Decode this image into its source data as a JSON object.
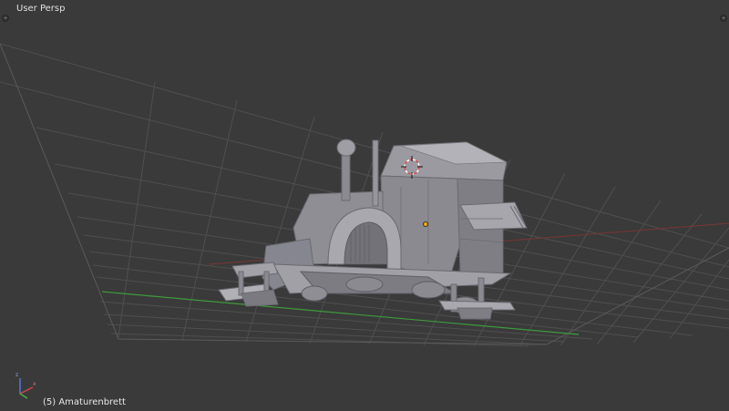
{
  "viewport": {
    "view_name": "User Persp",
    "active_object_label": "(5) Amaturenbrett"
  },
  "colors": {
    "background": "#3a3a3a",
    "grid": "#4d4d4d",
    "x_axis": "#8c3a3a",
    "y_axis": "#3f8c3f",
    "model": "#8e8e94",
    "model_shadow": "#6c6c72",
    "model_highlight": "#b4b4ba",
    "origin_dot": "#e8a317"
  },
  "icons": {
    "top_left_corner": "plus-icon",
    "top_right_corner": "plus-icon",
    "axis_gizmo": "axis-gizmo-icon",
    "cursor": "3d-cursor-icon",
    "origin": "object-origin-icon"
  }
}
